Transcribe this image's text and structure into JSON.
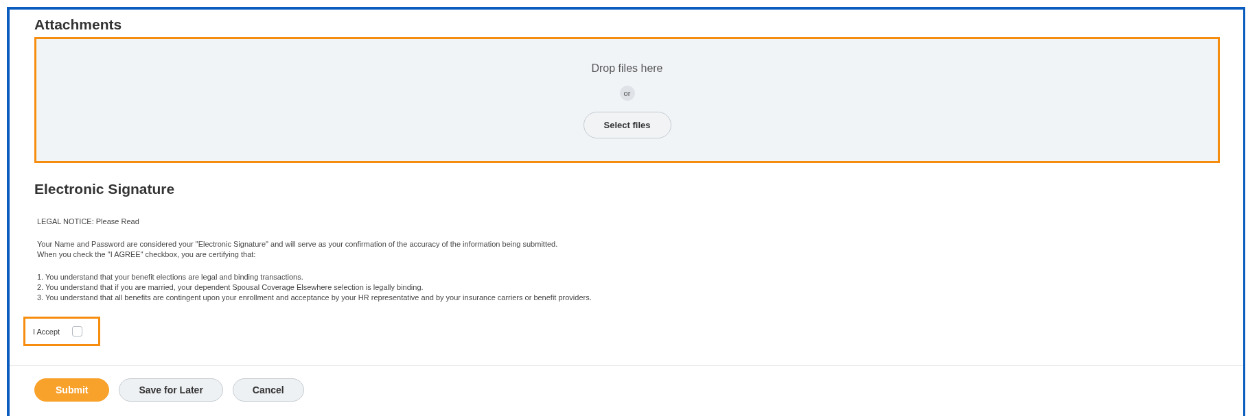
{
  "attachments": {
    "title": "Attachments",
    "drop_text": "Drop files here",
    "or_text": "or",
    "select_button": "Select files"
  },
  "signature": {
    "title": "Electronic Signature",
    "notice": [
      [
        "LEGAL NOTICE: Please Read"
      ],
      [
        "Your Name and Password are considered your \"Electronic Signature\" and will serve as your confirmation of the accuracy of the information being submitted.",
        "When you check the \"I AGREE\" checkbox, you are certifying that:"
      ],
      [
        "1. You understand that your benefit elections are legal and binding transactions.",
        "2. You understand that if you are married, your dependent Spousal Coverage Elsewhere selection is legally binding.",
        "3. You understand that all benefits are contingent upon your enrollment and acceptance by your HR representative and by your insurance carriers or benefit providers."
      ]
    ],
    "accept": {
      "label": "I Accept",
      "checked": false
    }
  },
  "buttons": [
    {
      "label": "Submit",
      "kind": "primary"
    },
    {
      "label": "Save for Later",
      "kind": "secondary"
    },
    {
      "label": "Cancel",
      "kind": "secondary"
    }
  ]
}
